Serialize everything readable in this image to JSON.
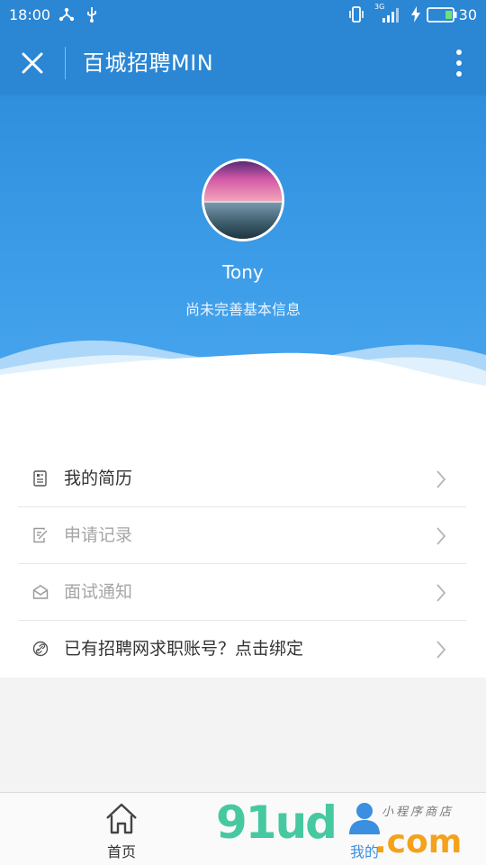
{
  "status_bar": {
    "time": "18:00",
    "network_badge": "3G",
    "battery_level": "30",
    "icons": [
      "share-icon",
      "usb-icon",
      "vibrate-icon",
      "signal-icon",
      "charging-icon",
      "battery-icon"
    ]
  },
  "title_bar": {
    "title": "百城招聘MIN",
    "close_icon": "close-icon",
    "more_icon": "more-vertical-icon"
  },
  "profile": {
    "username": "Tony",
    "subtitle": "尚未完善基本信息"
  },
  "menu": {
    "items": [
      {
        "label": "我的简历",
        "icon": "resume-icon",
        "muted": false
      },
      {
        "label": "申请记录",
        "icon": "edit-record-icon",
        "muted": true
      },
      {
        "label": "面试通知",
        "icon": "mail-icon",
        "muted": true
      },
      {
        "label": "已有招聘网求职账号？点击绑定",
        "icon": "link-icon",
        "muted": false
      }
    ]
  },
  "tab_bar": {
    "tabs": [
      {
        "label": "首页",
        "icon": "home-icon",
        "active": false
      },
      {
        "label": "我的",
        "icon": "user-icon",
        "active": true
      }
    ]
  },
  "watermark": {
    "brand": "91ud",
    "suffix": ".com",
    "tagline": "小程序商店"
  },
  "colors": {
    "primary": "#2b86d4",
    "hero_light": "#48a6ee",
    "active_tab": "#3a8fe0",
    "muted_text": "#a6a6a6"
  }
}
